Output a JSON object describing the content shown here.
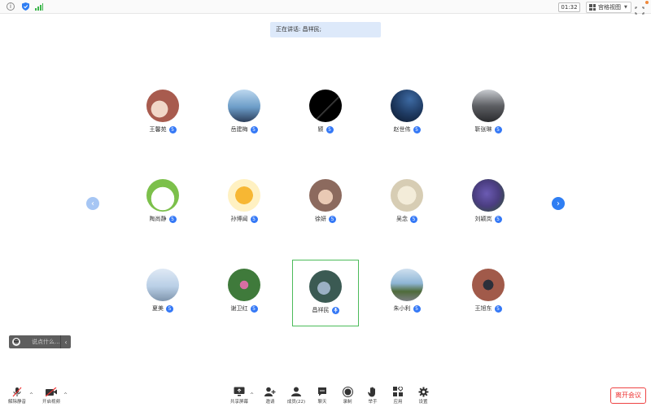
{
  "topbar": {
    "timer": "01:32",
    "view_label": "宫格视图",
    "icons": [
      "info-icon",
      "shield-icon",
      "signal-icon",
      "grid-icon",
      "fullscreen-icon"
    ]
  },
  "speaking": {
    "text": "正在讲话: 昌祥民;"
  },
  "participants": [
    {
      "name": "王馨苑",
      "badge": "5",
      "avatar_bg": "#a85b4e"
    },
    {
      "name": "岳建梅",
      "badge": "5",
      "avatar_bg": "#6b9cc7"
    },
    {
      "name": "颍",
      "badge": "5",
      "avatar_bg": "#0a0a0a"
    },
    {
      "name": "赵世伟",
      "badge": "5",
      "avatar_bg": "#1f3b63"
    },
    {
      "name": "靳张琳",
      "badge": "5",
      "avatar_bg": "#5d5f63"
    },
    {
      "name": "陶尚静",
      "badge": "5",
      "avatar_bg": "#7cc04b"
    },
    {
      "name": "孙博闻",
      "badge": "5",
      "avatar_bg": "#fff1c2"
    },
    {
      "name": "徐妍",
      "badge": "5",
      "avatar_bg": "#8c6a5e"
    },
    {
      "name": "吴念",
      "badge": "5",
      "avatar_bg": "#d7cdb4"
    },
    {
      "name": "刘颖岚",
      "badge": "5",
      "avatar_bg": "#4a3d80"
    },
    {
      "name": "夏美",
      "badge": "5",
      "avatar_bg": "#b9cfe6"
    },
    {
      "name": "谢卫红",
      "badge": "5",
      "avatar_bg": "#3f7a3b"
    },
    {
      "name": "昌祥民",
      "badge": "▓",
      "avatar_bg": "#3b5a53",
      "active": true
    },
    {
      "name": "朱小利",
      "badge": "5",
      "avatar_bg": "#8fb6d6"
    },
    {
      "name": "王旭东",
      "badge": "5",
      "avatar_bg": "#a15a4a"
    }
  ],
  "chat": {
    "placeholder": "说点什么..."
  },
  "toolbar": {
    "mute": "解除静音",
    "video": "开启视频",
    "share": "共享屏幕",
    "invite": "邀请",
    "members": "成员(22)",
    "chat": "聊天",
    "record": "录制",
    "raise": "举手",
    "apps": "应用",
    "settings": "设置",
    "leave": "离开会议"
  },
  "colors": {
    "accent": "#2f7ef3",
    "leave": "#e33333",
    "active_border": "#4cbb5a",
    "badge": "#3478f6"
  }
}
